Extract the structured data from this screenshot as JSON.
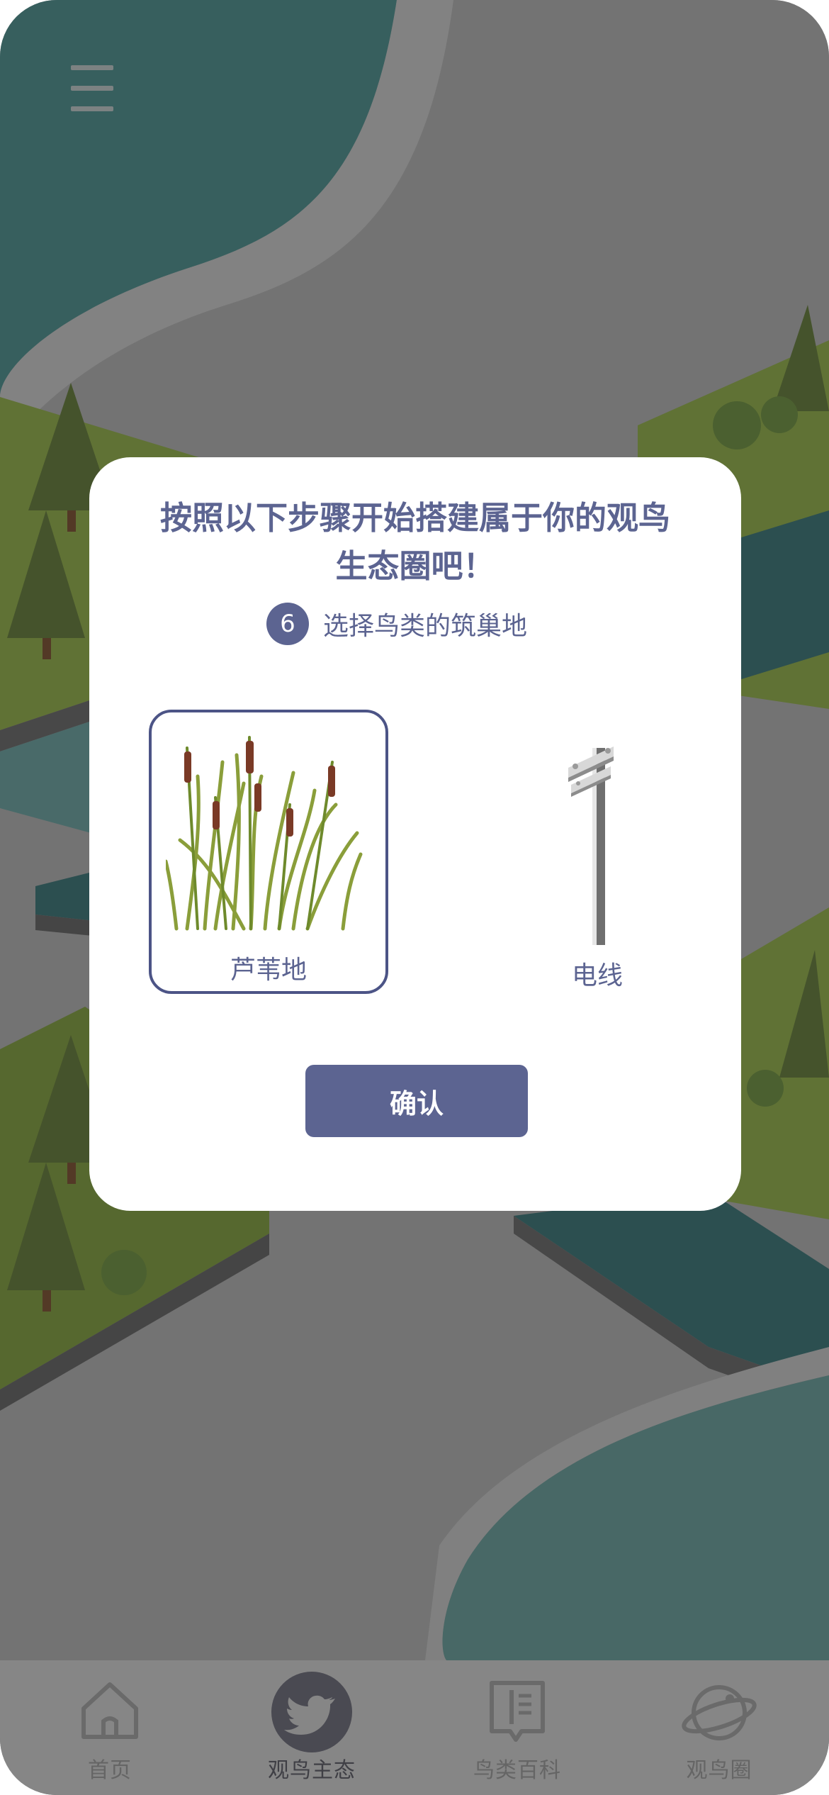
{
  "app": {
    "menu_icon": "hamburger-menu-icon"
  },
  "modal": {
    "title": "按照以下步骤开始搭建属于你的观鸟生态圈吧！",
    "step_number": "6",
    "step_text": "选择鸟类的筑巢地",
    "options": [
      {
        "label": "芦苇地",
        "icon": "reed-illustration",
        "selected": true
      },
      {
        "label": "电线",
        "icon": "utility-pole-illustration",
        "selected": false
      }
    ],
    "confirm_label": "确认"
  },
  "tabbar": {
    "items": [
      {
        "label": "首页",
        "icon": "home-icon",
        "active": false
      },
      {
        "label": "观鸟主态",
        "icon": "bird-icon",
        "active": true
      },
      {
        "label": "鸟类百科",
        "icon": "book-icon",
        "active": false
      },
      {
        "label": "观鸟圈",
        "icon": "planet-icon",
        "active": false
      }
    ]
  },
  "colors": {
    "accent": "#5c6491",
    "water": "#2f6466",
    "grass": "#8aa13a",
    "road": "#9a9a9a"
  }
}
